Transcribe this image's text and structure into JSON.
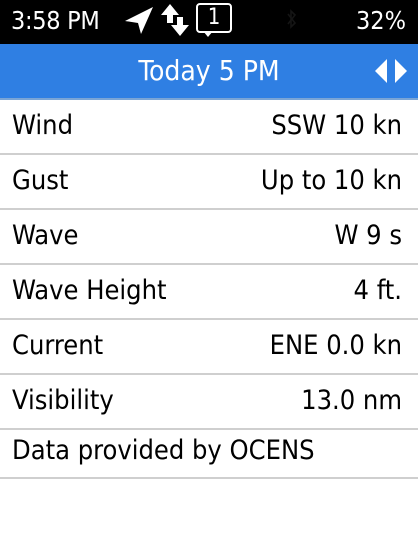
{
  "status_bar": {
    "time": "3:58 PM",
    "notification_count": "1",
    "battery": "32%",
    "icons": [
      "location-arrow-icon",
      "sync-arrows-icon",
      "notification-count-icon",
      "bluetooth-icon"
    ]
  },
  "header": {
    "title": "Today 5 PM",
    "background_color": "#2f7fe3",
    "nav_icons": [
      "prev-arrow-icon",
      "next-arrow-icon"
    ]
  },
  "forecast": {
    "rows": [
      {
        "label": "Wind",
        "value": "SSW  10 kn"
      },
      {
        "label": "Gust",
        "value": "Up to 10 kn"
      },
      {
        "label": "Wave",
        "value": "W  9 s"
      },
      {
        "label": "Wave Height",
        "value": "4 ft."
      },
      {
        "label": "Current",
        "value": "ENE  0.0 kn"
      },
      {
        "label": "Visibility",
        "value": "13.0 nm"
      }
    ]
  },
  "footer": {
    "credit": "Data provided by OCENS"
  }
}
